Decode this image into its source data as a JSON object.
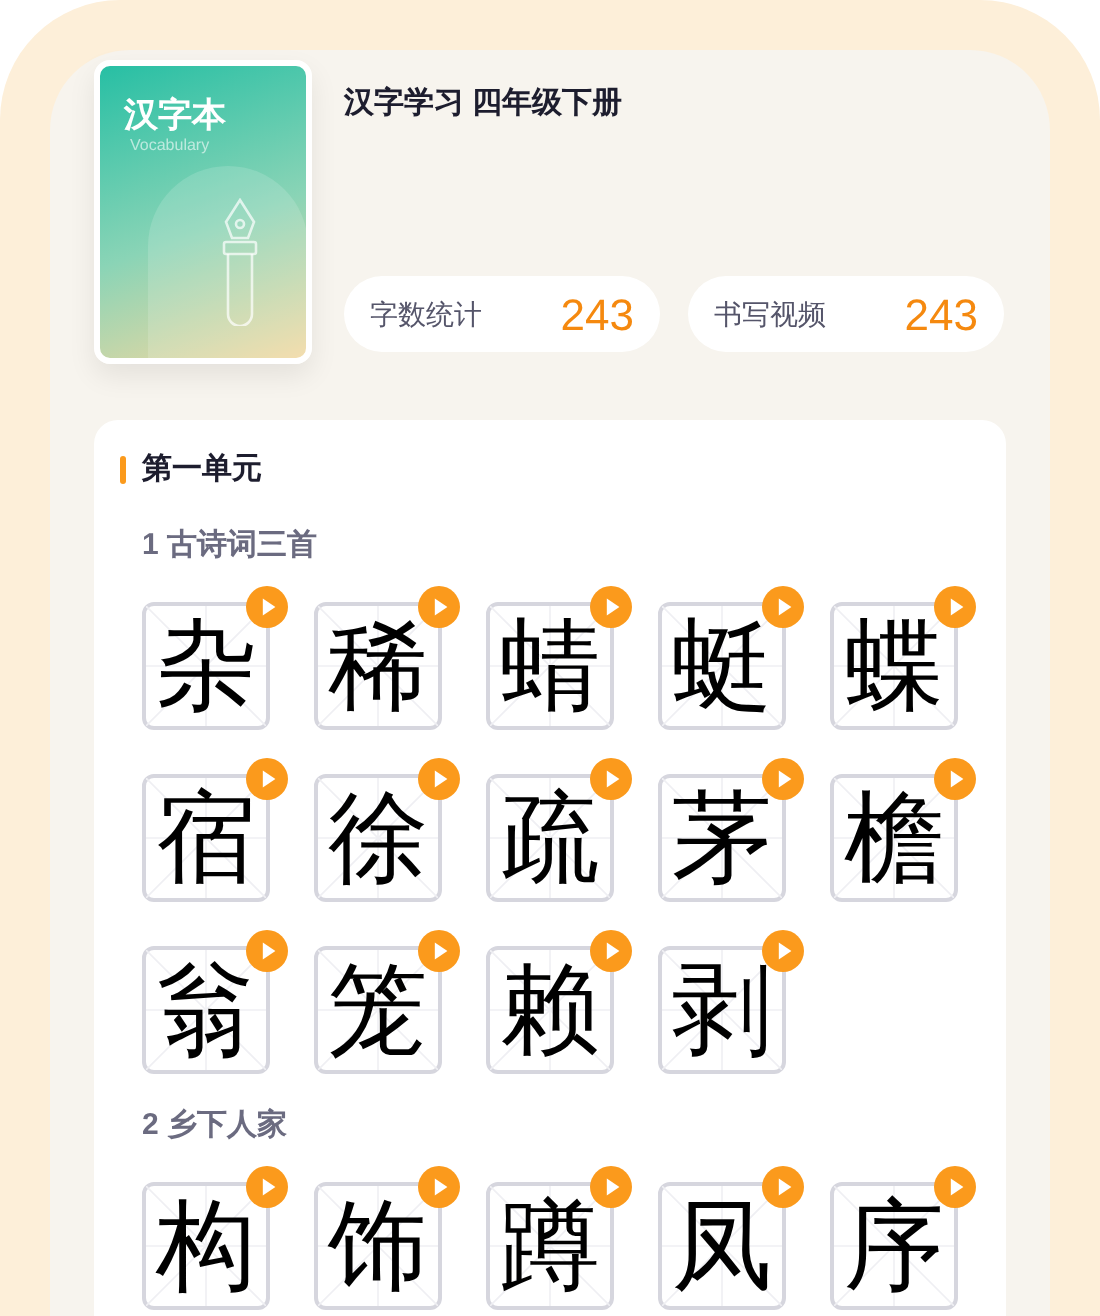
{
  "book": {
    "cover_title": "汉字本",
    "cover_subtitle": "Vocabulary",
    "title": "汉字学习 四年级下册"
  },
  "stats": [
    {
      "label": "字数统计",
      "value": "243"
    },
    {
      "label": "书写视频",
      "value": "243"
    }
  ],
  "units": [
    {
      "title": "第一单元",
      "lessons": [
        {
          "title": "1 古诗词三首",
          "characters": [
            "杂",
            "稀",
            "蜻",
            "蜓",
            "蝶",
            "宿",
            "徐",
            "疏",
            "茅",
            "檐",
            "翁",
            "笼",
            "赖",
            "剥"
          ]
        },
        {
          "title": "2 乡下人家",
          "characters": [
            "构",
            "饰",
            "蹲",
            "凤",
            "序"
          ]
        }
      ]
    }
  ]
}
